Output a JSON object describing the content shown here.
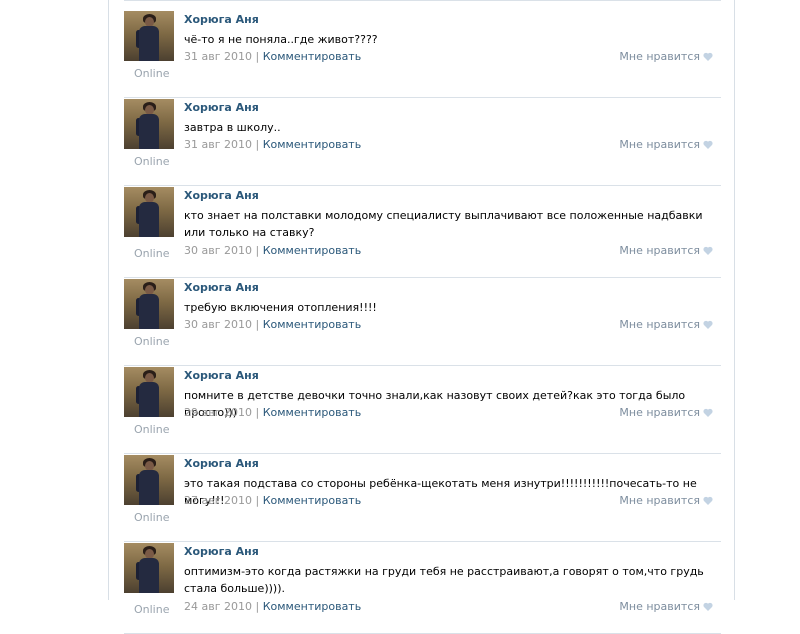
{
  "status_label": "Online",
  "like_label": "Мне нравится",
  "comment_label": "Комментировать",
  "separator": "|",
  "colors": {
    "link": "#2b587a",
    "muted": "#999999",
    "online": "#9aa4ae",
    "divider": "#dae1e8"
  },
  "posts": [
    {
      "author": "Хорюга Аня",
      "text": "чё-то я не поняла..где живот????",
      "date": "31 авг 2010"
    },
    {
      "author": "Хорюга Аня",
      "text": "завтра в школу..",
      "date": "31 авг 2010"
    },
    {
      "author": "Хорюга Аня",
      "text": "кто знает на полставки молодому специалисту выплачивают все положенные надбавки или только на ставку?",
      "date": "30 авг 2010"
    },
    {
      "author": "Хорюга Аня",
      "text": "требую включения отопления!!!!",
      "date": "30 авг 2010"
    },
    {
      "author": "Хорюга Аня",
      "text": "помните в детстве девочки точно знали,как назовут своих детей?как это тогда было просто)))",
      "date": "29 авг 2010"
    },
    {
      "author": "Хорюга Аня",
      "text": "это такая подстава со стороны ребёнка-щекотать меня изнутри!!!!!!!!!!!почесать-то не могу!!!",
      "date": "27 авг 2010"
    },
    {
      "author": "Хорюга Аня",
      "text": "оптимизм-это когда растяжки на груди тебя не расстраивают,а говорят о том,что грудь стала больше)))).",
      "date": "24 авг 2010"
    }
  ]
}
